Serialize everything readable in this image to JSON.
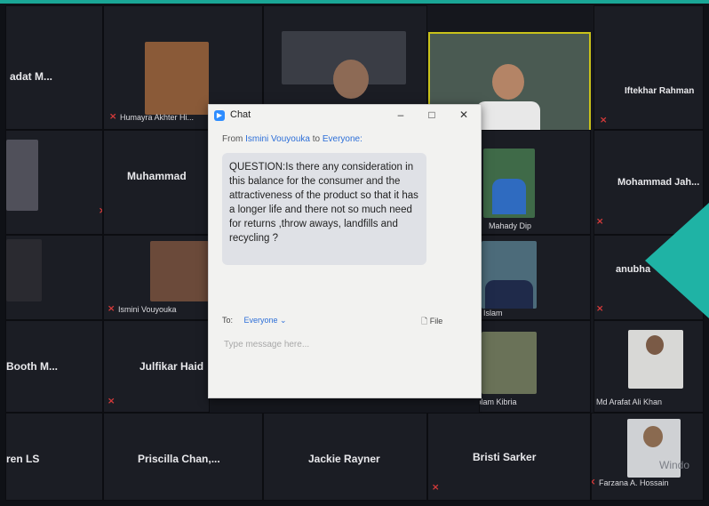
{
  "window": {
    "title": "Chat",
    "minimize": "–",
    "maximize": "□",
    "close": "✕"
  },
  "chat": {
    "from_prefix": "From",
    "sender": "Ismini Vouyouka",
    "to_text": "to",
    "recipient": "Everyone:",
    "message": "QUESTION:Is there any consideration in this balance for the consumer and the attractiveness of the product so that it has a longer life and there not so much need for returns ,throw aways, landfills and recycling ?",
    "to_label": "To:",
    "to_value": "Everyone ⌄",
    "file_label": "File",
    "input_placeholder": "Type message here..."
  },
  "participants": {
    "sadat": "adat M...",
    "humayra": "Humayra Akhter Hi...",
    "iftekhar": "Iftekhar Rahman",
    "muhammad": "Muhammad",
    "mohammad": "Mohammad Jah...",
    "mahady": "Mahady Dip",
    "anubha": "anubha",
    "ismini": "Ismini Vouyouka",
    "islam": "Islam",
    "booth": "Booth M...",
    "julfikar": "Julfikar Haid",
    "golam": "Md. Golam Kibria",
    "arafat": "Md Arafat Ali Khan",
    "laren": "ren LS",
    "priscilla": "Priscilla Chan,...",
    "jackie": "Jackie Rayner",
    "bristi": "Bristi Sarker",
    "farzana": "Farzana A. Hossain"
  },
  "watermark": "Windo",
  "colors": {
    "accent_teal": "#1fb3a5",
    "zoom_blue": "#2d8cff",
    "active_speaker": "#c9c21a",
    "muted_red": "#d63a3a"
  }
}
